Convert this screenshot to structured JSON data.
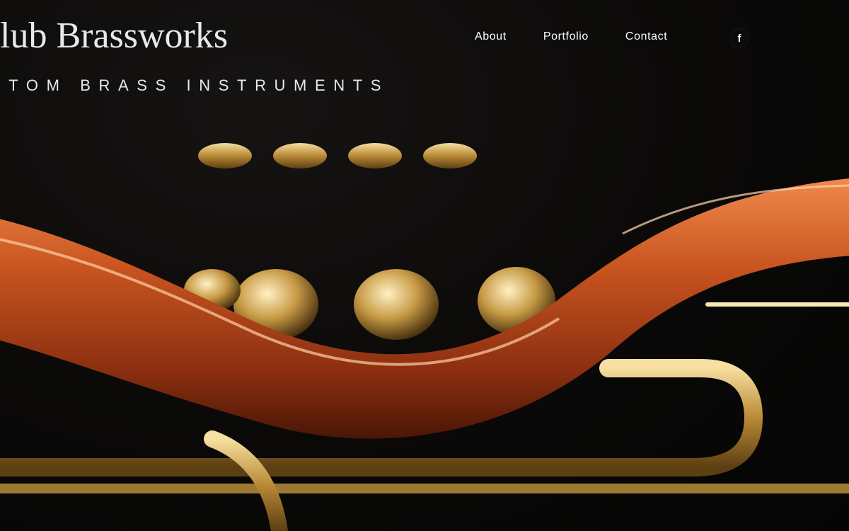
{
  "site": {
    "title": "hlub Brassworks",
    "tagline": "STOM BRASS INSTRUMENTS"
  },
  "nav": {
    "items": [
      {
        "label": "About"
      },
      {
        "label": "Portfolio"
      },
      {
        "label": "Contact"
      }
    ]
  },
  "social": {
    "facebook_glyph": "f",
    "icon": "facebook-icon"
  },
  "hero_image": {
    "subject": "close-up of a copper and brass rotary valve instrument",
    "colors": {
      "background": "#080707",
      "copper": "#c2521e",
      "brass": "#c9a24a"
    }
  }
}
